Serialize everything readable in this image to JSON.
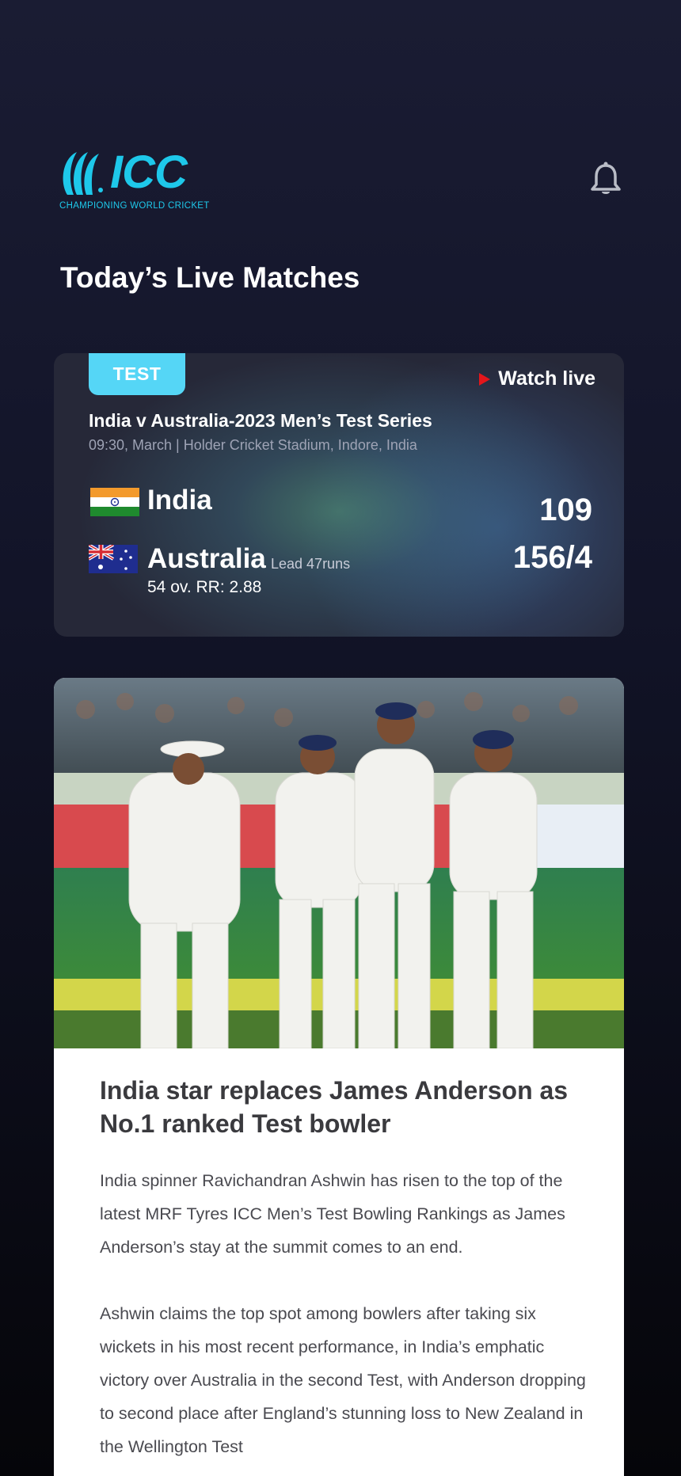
{
  "header": {
    "logo_text": "ICC",
    "logo_tagline": "CHAMPIONING WORLD CRICKET"
  },
  "section_title": "Today’s Live Matches",
  "match": {
    "format": "TEST",
    "watch_label": "Watch live",
    "series": "India v Australia-2023 Men’s Test Series",
    "meta": "09:30, March | Holder Cricket Stadium, Indore, India",
    "team1": {
      "name": "India",
      "score": "109",
      "flag": "india-flag"
    },
    "team2": {
      "name": "Australia",
      "score": "156/4",
      "lead": "Lead 47runs",
      "overs": "54 ov. RR: 2.88",
      "flag": "australia-flag"
    }
  },
  "news": {
    "image": "cricket-team-celebration-photo",
    "title": "India star replaces James Anderson as No.1 ranked Test bowler",
    "p1": "India spinner Ravichandran Ashwin has risen to the top of the latest MRF Tyres ICC Men’s Test Bowling Rankings as James Anderson’s stay at the summit comes to an end.",
    "p2": "Ashwin claims the top spot among bowlers after taking six wickets in his most recent performance, in India’s emphatic victory over Australia in the second Test, with Anderson dropping to second place after England’s stunning loss to New Zealand in the Wellington Test"
  },
  "colors": {
    "accent": "#1ec8ea",
    "badge": "#55d6f6",
    "live_red": "#e3161b"
  }
}
